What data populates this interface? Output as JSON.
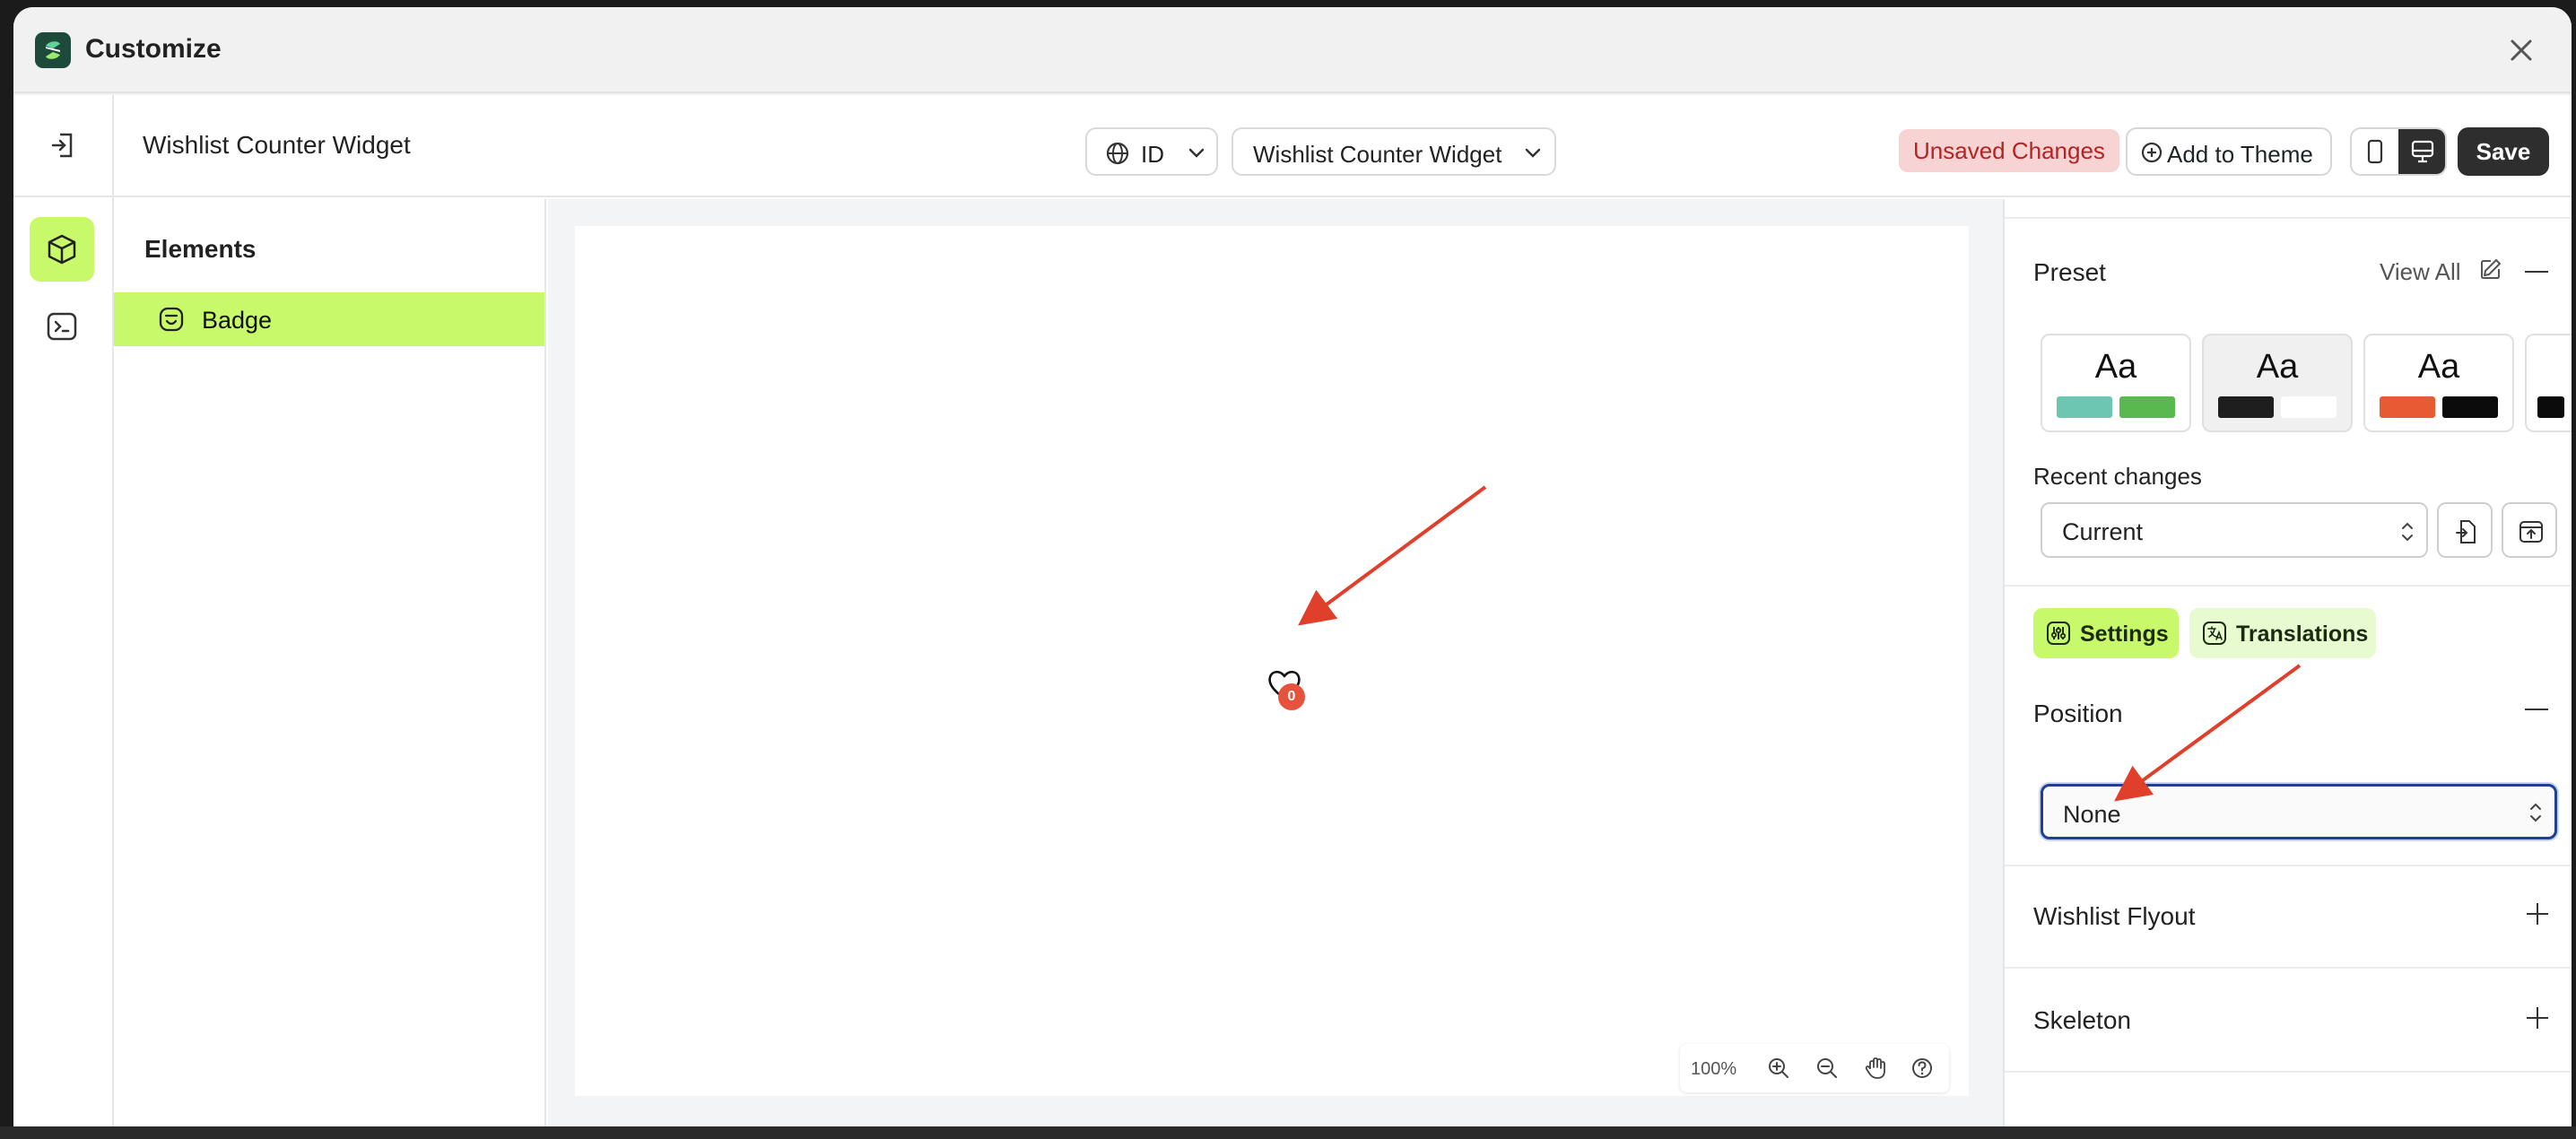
{
  "window": {
    "title": "Customize"
  },
  "header": {
    "widget_title": "Wishlist Counter Widget",
    "language": "ID",
    "template_select": "Wishlist Counter Widget",
    "status_badge": "Unsaved Changes",
    "add_to_theme": "Add to Theme",
    "save": "Save"
  },
  "elements": {
    "heading": "Elements",
    "items": [
      {
        "label": "Badge",
        "selected": true
      }
    ]
  },
  "canvas": {
    "badge_count": "0",
    "zoom": "100%"
  },
  "panel": {
    "preset": {
      "title": "Preset",
      "view_all": "View All",
      "cards": [
        {
          "sample": "Aa",
          "colors": [
            "#6cc6b0",
            "#59b84f"
          ]
        },
        {
          "sample": "Aa",
          "colors": [
            "#1e1e1e",
            "#ffffff"
          ],
          "selected": true
        },
        {
          "sample": "Aa",
          "colors": [
            "#e85a34",
            "#0b0b0b"
          ]
        }
      ]
    },
    "recent_changes": {
      "label": "Recent changes",
      "value": "Current"
    },
    "tabs": [
      {
        "label": "Settings",
        "active": true
      },
      {
        "label": "Translations",
        "active": false
      }
    ],
    "position": {
      "title": "Position",
      "value": "None"
    },
    "sections": [
      {
        "title": "Wishlist Flyout"
      },
      {
        "title": "Skeleton"
      }
    ]
  },
  "colors": {
    "accent": "#c8f96a",
    "badge": "#e5533d",
    "annotation_arrow": "#e0402b",
    "focus_ring": "#1f3f8f"
  }
}
